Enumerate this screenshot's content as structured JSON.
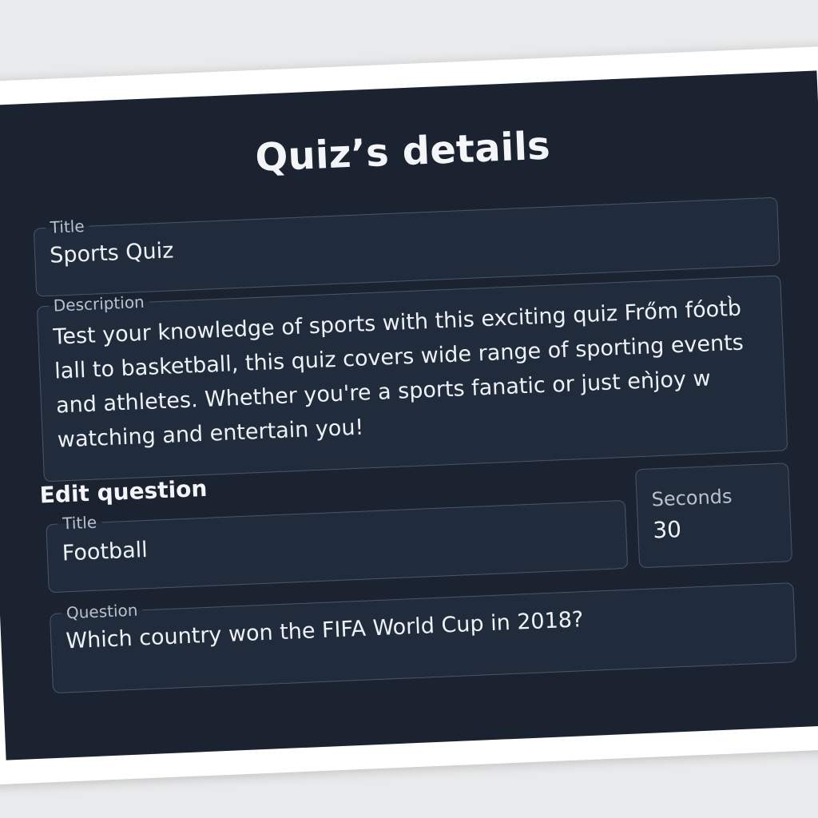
{
  "page": {
    "title": "Quiz’s details"
  },
  "quiz": {
    "title_label": "Title",
    "title_value": "Sports Quiz",
    "description_label": "Description",
    "description_lines": [
      "Test your knowledge of sports with this exciting quiz Frőm fóotb̀",
      "lall to basketball, this quiz covers wide range of sporting events",
      "and athletes. Whether you're a sports fanatic or just eǹjoy w",
      "watching and entertain you!"
    ]
  },
  "edit_question": {
    "heading": "Edit question",
    "title_label": "Title",
    "title_value": "Football",
    "seconds_label": "Seconds",
    "seconds_value": "30",
    "question_label": "Question",
    "question_value": "Which country won the FIFA World Cup in 2018?"
  },
  "colors": {
    "panel_background": "#1b2331",
    "field_background": "#202c3c",
    "field_border": "#4a5668",
    "page_background": "#e9eaeb"
  }
}
